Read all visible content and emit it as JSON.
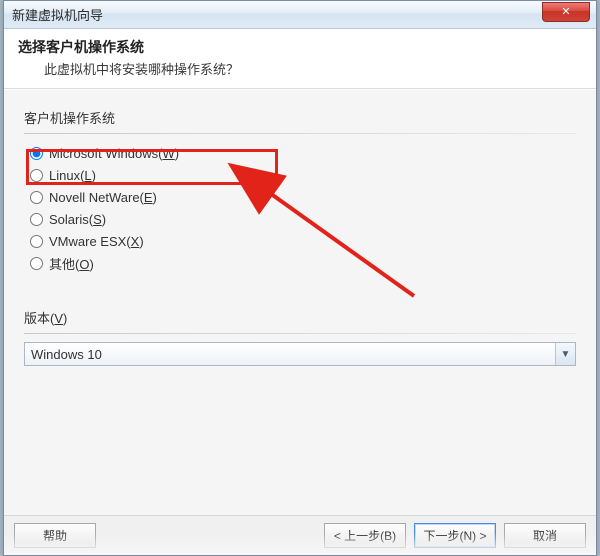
{
  "window": {
    "title": "新建虚拟机向导",
    "close_symbol": "✕"
  },
  "header": {
    "title": "选择客户机操作系统",
    "subtitle": "此虚拟机中将安装哪种操作系统？"
  },
  "os_group": {
    "label": "客户机操作系统",
    "options": [
      {
        "label": "Microsoft Windows",
        "hotkey": "W",
        "checked": true
      },
      {
        "label": "Linux",
        "hotkey": "L",
        "checked": false
      },
      {
        "label": "Novell NetWare",
        "hotkey": "E",
        "checked": false
      },
      {
        "label": "Solaris",
        "hotkey": "S",
        "checked": false
      },
      {
        "label": "VMware ESX",
        "hotkey": "X",
        "checked": false
      },
      {
        "label": "其他",
        "hotkey": "O",
        "checked": false
      }
    ]
  },
  "version": {
    "label": "版本",
    "hotkey": "V",
    "selected": "Windows 10"
  },
  "buttons": {
    "help": "帮助",
    "back": "< 上一步(B)",
    "next": "下一步(N) >",
    "cancel": "取消"
  }
}
